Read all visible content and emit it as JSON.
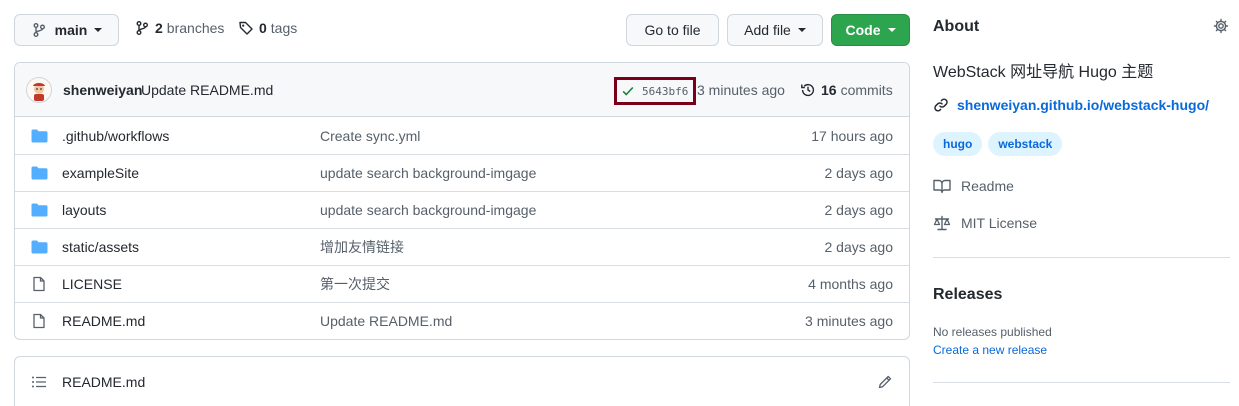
{
  "branch": {
    "name": "main"
  },
  "branches": {
    "count": "2",
    "label": "branches"
  },
  "tags": {
    "count": "0",
    "label": "tags"
  },
  "buttons": {
    "go_to_file": "Go to file",
    "add_file": "Add file",
    "code": "Code"
  },
  "commit": {
    "author": "shenweiyan",
    "message": "Update README.md",
    "sha": "5643bf6",
    "time": "3 minutes ago",
    "commits_count": "16",
    "commits_label": "commits"
  },
  "files": [
    {
      "type": "dir",
      "name": ".github/workflows",
      "message": "Create sync.yml",
      "age": "17 hours ago"
    },
    {
      "type": "dir",
      "name": "exampleSite",
      "message": "update search background-imgage",
      "age": "2 days ago"
    },
    {
      "type": "dir",
      "name": "layouts",
      "message": "update search background-imgage",
      "age": "2 days ago"
    },
    {
      "type": "dir",
      "name": "static/assets",
      "message": "增加友情链接",
      "age": "2 days ago"
    },
    {
      "type": "file",
      "name": "LICENSE",
      "message": "第一次提交",
      "age": "4 months ago"
    },
    {
      "type": "file",
      "name": "README.md",
      "message": "Update README.md",
      "age": "3 minutes ago"
    }
  ],
  "readme": {
    "title": "README.md"
  },
  "about": {
    "heading": "About",
    "description": "WebStack 网址导航 Hugo 主题",
    "website": "shenweiyan.github.io/webstack-hugo/",
    "topics": [
      "hugo",
      "webstack"
    ],
    "readme_link": "Readme",
    "license_link": "MIT License"
  },
  "releases": {
    "heading": "Releases",
    "none": "No releases published",
    "create": "Create a new release"
  },
  "colors": {
    "accent_link": "#0969da",
    "code_button": "#2da44e",
    "success_check": "#1a7f37",
    "folder_icon": "#54aeff",
    "highlight_box": "#7a0019"
  }
}
